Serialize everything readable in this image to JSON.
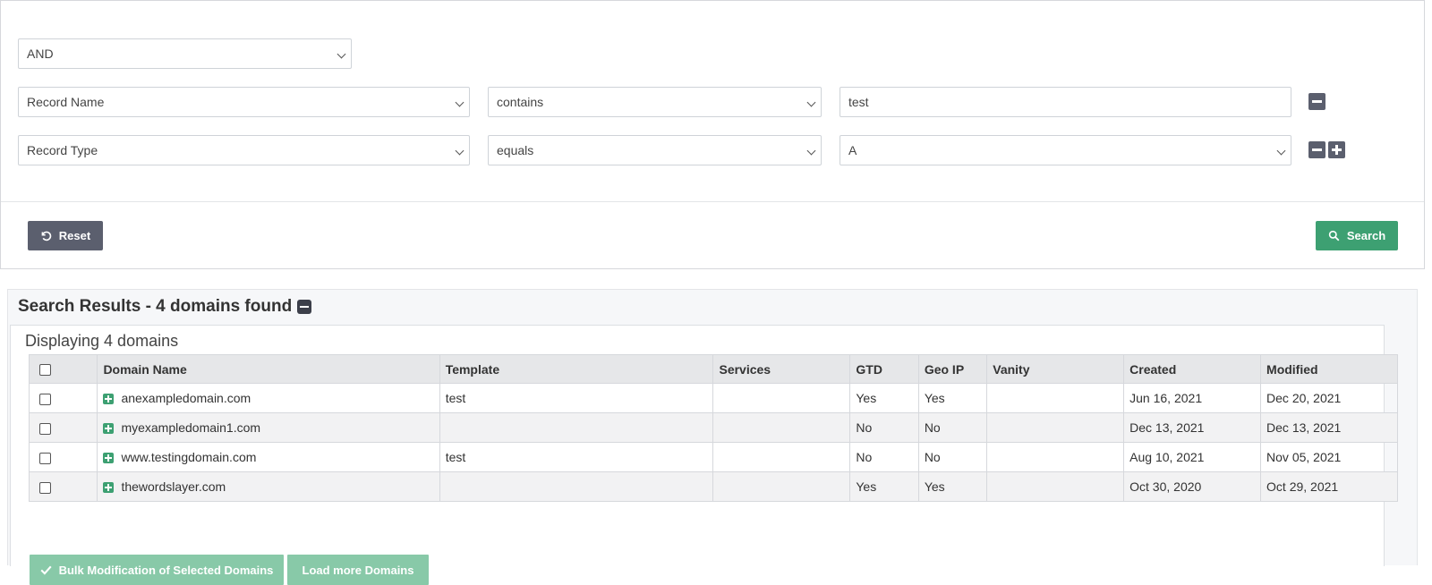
{
  "filters": {
    "logic_operator": "AND",
    "rows": [
      {
        "field": "Record Name",
        "operator": "contains",
        "value": "test"
      },
      {
        "field": "Record Type",
        "operator": "equals",
        "value": "A"
      }
    ]
  },
  "actions": {
    "reset_label": "Reset",
    "search_label": "Search"
  },
  "results": {
    "title": "Search Results - 4 domains found",
    "displaying": "Displaying 4 domains",
    "columns": [
      "Domain Name",
      "Template",
      "Services",
      "GTD",
      "Geo IP",
      "Vanity",
      "Created",
      "Modified"
    ],
    "rows": [
      {
        "domain": "anexampledomain.com",
        "template": "test",
        "services": "",
        "gtd": "Yes",
        "geoip": "Yes",
        "vanity": "",
        "created": "Jun 16, 2021",
        "modified": "Dec 20, 2021"
      },
      {
        "domain": "myexampledomain1.com",
        "template": "",
        "services": "",
        "gtd": "No",
        "geoip": "No",
        "vanity": "",
        "created": "Dec 13, 2021",
        "modified": "Dec 13, 2021"
      },
      {
        "domain": "www.testingdomain.com",
        "template": "test",
        "services": "",
        "gtd": "No",
        "geoip": "No",
        "vanity": "",
        "created": "Aug 10, 2021",
        "modified": "Nov 05, 2021"
      },
      {
        "domain": "thewordslayer.com",
        "template": "",
        "services": "",
        "gtd": "Yes",
        "geoip": "Yes",
        "vanity": "",
        "created": "Oct 30, 2020",
        "modified": "Oct 29, 2021"
      }
    ],
    "bulk_label": "Bulk Modification of Selected Domains",
    "load_more_label": "Load more Domains"
  },
  "colors": {
    "accent_green": "#3da072",
    "light_green": "#88c9a8",
    "dark_gray_button": "#5b5f6e"
  }
}
